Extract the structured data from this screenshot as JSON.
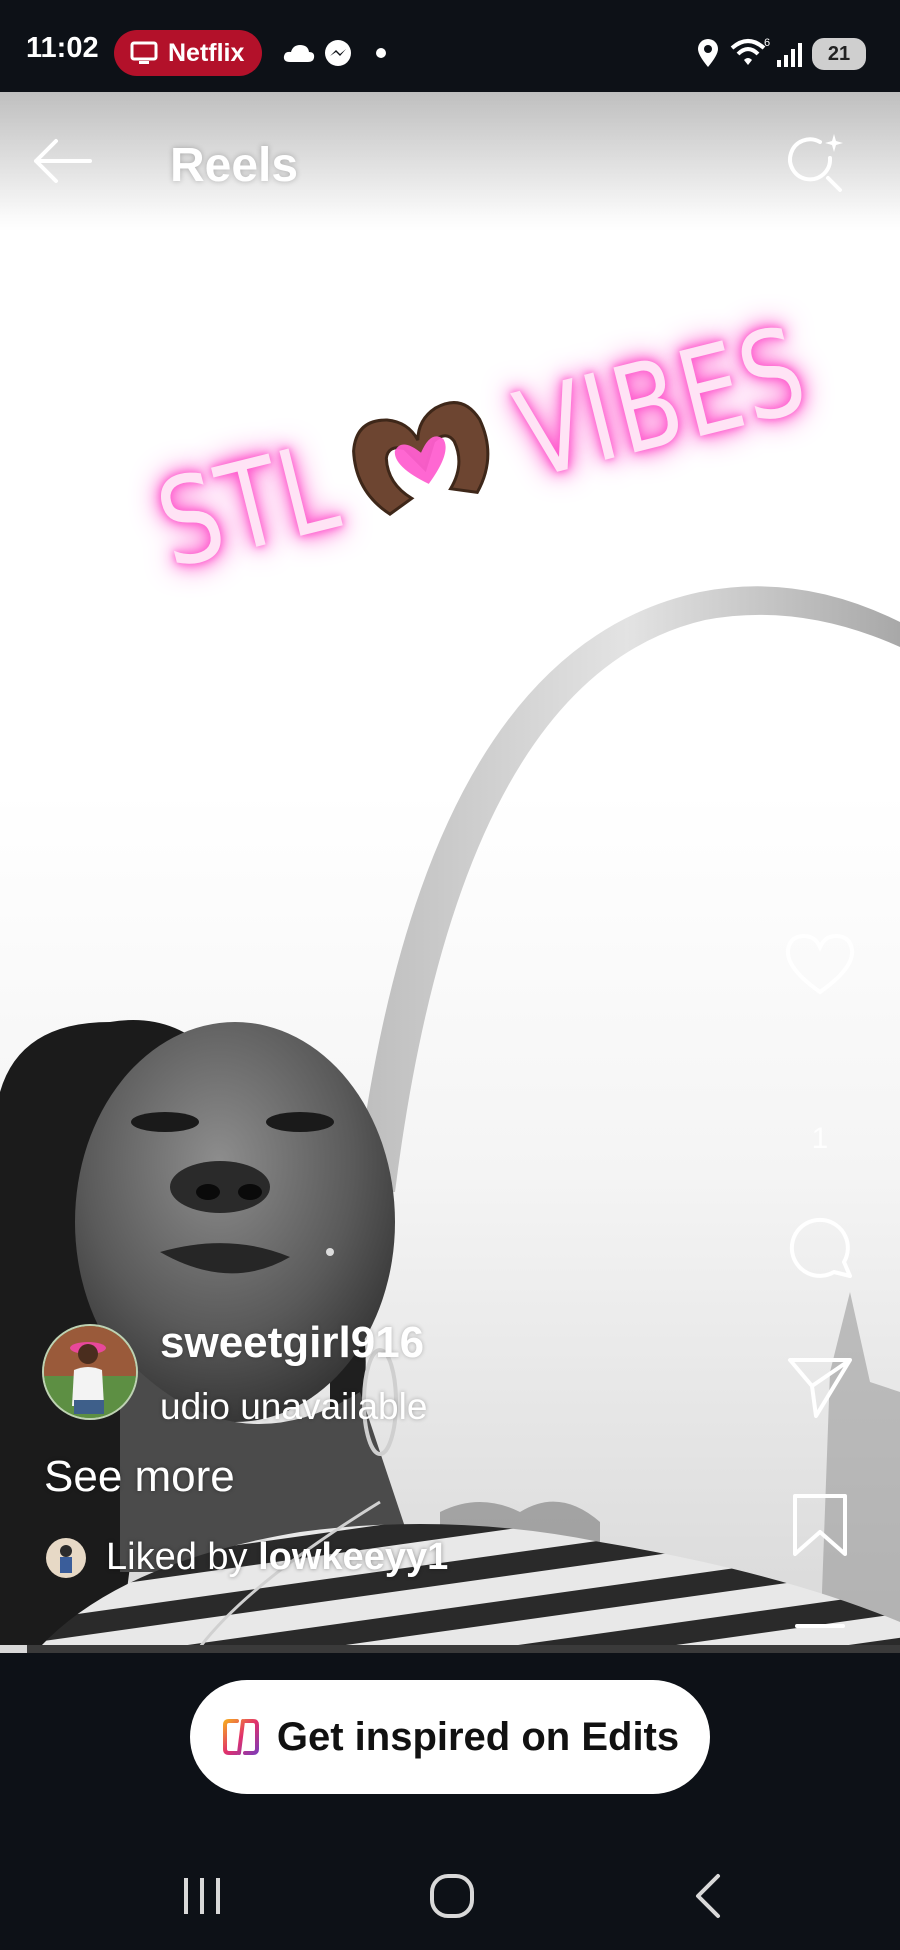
{
  "status_bar": {
    "time": "11:02",
    "netflix_label": "Netflix",
    "battery_level": "21",
    "icons": [
      "tv-icon",
      "cloud-icon",
      "messenger-icon",
      "dot-icon",
      "location-icon",
      "wifi-icon",
      "signal-icon",
      "battery-icon"
    ]
  },
  "header": {
    "title": "Reels",
    "back_icon": "arrow-left-icon",
    "camera_icon": "camera-sparkle-icon"
  },
  "reel": {
    "overlay_text_left": "STL",
    "overlay_text_right": "VIBES",
    "overlay_emoji": "heart-hands-icon",
    "glow_color": "#ff3fc4"
  },
  "actions": {
    "like_icon": "heart-icon",
    "like_count": "1",
    "comment_icon": "comment-icon",
    "share_icon": "send-icon",
    "save_icon": "bookmark-icon",
    "more_icon": "menu-icon"
  },
  "caption": {
    "username": "sweetgirl916",
    "audio": "udio unavailable",
    "see_more": "See more",
    "liked_prefix": "Liked by ",
    "liked_user": "lowkeeyy1"
  },
  "progress": {
    "fraction": 0.03
  },
  "edits_button": {
    "label": "Get inspired on Edits",
    "icon": "edits-logo-icon"
  },
  "nav": {
    "recents_icon": "recents-icon",
    "home_icon": "home-icon",
    "back_icon": "back-icon"
  }
}
